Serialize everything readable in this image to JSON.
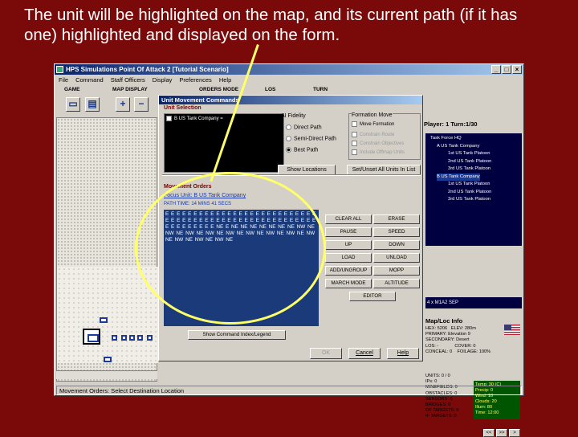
{
  "caption": "The unit will be highlighted on the map, and its current path (if it has one) highlighted and displayed on the form.",
  "app": {
    "title": "HPS Simulations Point Of Attack 2 [Tutorial Scenario]",
    "menu": [
      "File",
      "Command",
      "Staff Officers",
      "Display",
      "Preferences",
      "Help"
    ],
    "toolbar_groups": [
      "GAME",
      "MAP DISPLAY",
      "ORDERS MODE",
      "LOS",
      "TURN"
    ],
    "status": "Movement Orders: Select Destination Location"
  },
  "right_panel": {
    "player": "Player: 1  Turn:1/30",
    "tree": [
      "Task Force HQ",
      "A US Tank Company",
      "1st US Tank Platoon",
      "2nd US Tank Platoon",
      "3rd US Tank Platoon",
      "B US Tank Company",
      "1st US Tank Platoon",
      "2nd US Tank Platoon",
      "3rd US Tank Platoon"
    ],
    "unit_type": "4 x M1A2 SEP",
    "map_info_title": "Map/Loc Info",
    "hex": "HEX: 5206",
    "elev": "ELEV: 280m",
    "primary": "PRIMARY: Elevation 9",
    "secondary": "SECONDARY: Desert",
    "los": "LOS: -",
    "cover": "COVER: 0",
    "conceal": "CONCEAL: 0",
    "foliage": "FOILAGE: 100%",
    "units": "UNITS: 0 / 0",
    "ips": "IPs: 0",
    "minefields": "MINEFIELDS: 0",
    "obstacles": "OBSTACLES: 0",
    "sensors": "SENSORS: 0",
    "bridges": "BRIDGES: 0",
    "of_targets": "OF TARGETS: 0",
    "if_targets": "IF TARGETS: 0",
    "weather": [
      "Temp: 30 (C)",
      "Precip: 0",
      "Wind: 10",
      "Clouds: 20",
      "Illum: 80",
      "Time: 12:00"
    ],
    "nav": [
      "<<",
      ">>",
      ">"
    ]
  },
  "dialog": {
    "title": "Unit Movement Commands",
    "unit_selection_label": "Unit Selection",
    "unit_item": "B  US Tank Company =",
    "ai_fidelity_label": "AI Fidelity",
    "radios": [
      "Direct Path",
      "Semi-Direct Path",
      "Best Path"
    ],
    "formation_label": "Formation Move",
    "formation_items": [
      "Move Formation",
      "Constrain Route",
      "Constrain Objectives",
      "Include Offmap Units"
    ],
    "show_locations": "Show Locations",
    "set_unset": "Set/Unset All Units In List",
    "movement_orders_label": "Movement Orders",
    "focus_unit": "Focus Unit: B  US Tank Company",
    "path_time": "PATH TIME: 14 MINS 41 SECS",
    "orders_text": "E E E E E E E E E E E E E E E E E E E E E E E E E E E E E E E E E E E E E E E E E E E E E E E E E E E E E E E E E E E E E E E NE E NE NE NE NE NE NE NE NW NE NW NE NW NE NW NE NW NE NW NE NW NE NW NE NW NE NW NE NW NE NW NE",
    "controls": [
      "CLEAR ALL",
      "ERASE",
      "PAUSE",
      "SPEED",
      "UP",
      "DOWN",
      "LOAD",
      "UNLOAD",
      "ADD/UNGROUP",
      "MOPP",
      "MARCH MODE",
      "ALTITUDE",
      "EDITOR"
    ],
    "show_command_index": "Show Command Index/Legend",
    "ok": "OK",
    "cancel": "Cancel",
    "help": "Help"
  }
}
